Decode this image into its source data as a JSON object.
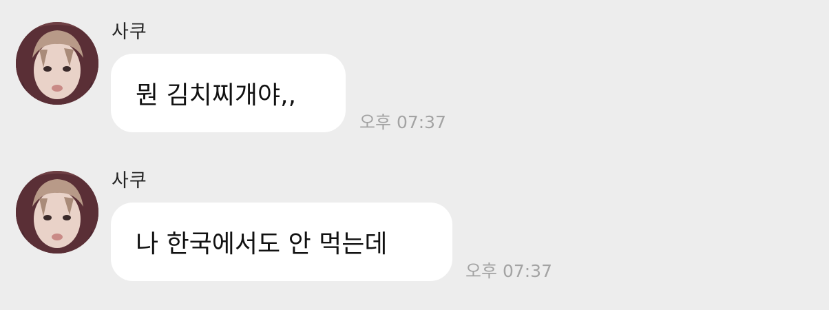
{
  "messages": [
    {
      "sender": "사쿠",
      "text": "뭔 김치찌개야,,",
      "time": "오후 07:37",
      "avatar_icon": "profile-photo"
    },
    {
      "sender": "사쿠",
      "text": "나 한국에서도 안 먹는데",
      "time": "오후 07:37",
      "avatar_icon": "profile-photo"
    }
  ],
  "colors": {
    "background": "#ededed",
    "bubble": "#ffffff",
    "time_text": "#a3a3a3"
  }
}
